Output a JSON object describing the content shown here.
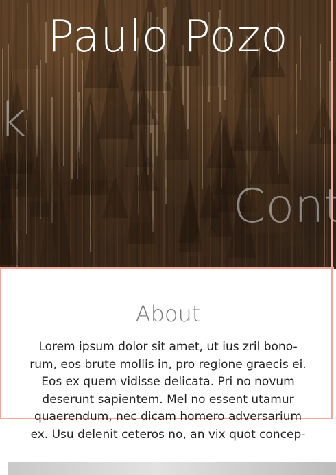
{
  "hero": {
    "title": "Paulo Pozo",
    "ghost_work": "Work",
    "ghost_contact": "Contact"
  },
  "about": {
    "heading": "About",
    "body_lines": [
      "Lorem ipsum dolor sit amet, ut ius zril bono-",
      "rum, eos brute mollis in, pro regione graecis ei.",
      "Eos ex quem vidisse delicata. Pri no novum",
      "deserunt sapientem. Mel no essent utamur",
      "quaerendum, nec dicam homero adversarium",
      "ex. Usu delenit ceteros no, an vix quot concep-"
    ]
  },
  "colors": {
    "frame": "#f1a79b",
    "heading": "#7a7a7a",
    "text": "#222222"
  }
}
